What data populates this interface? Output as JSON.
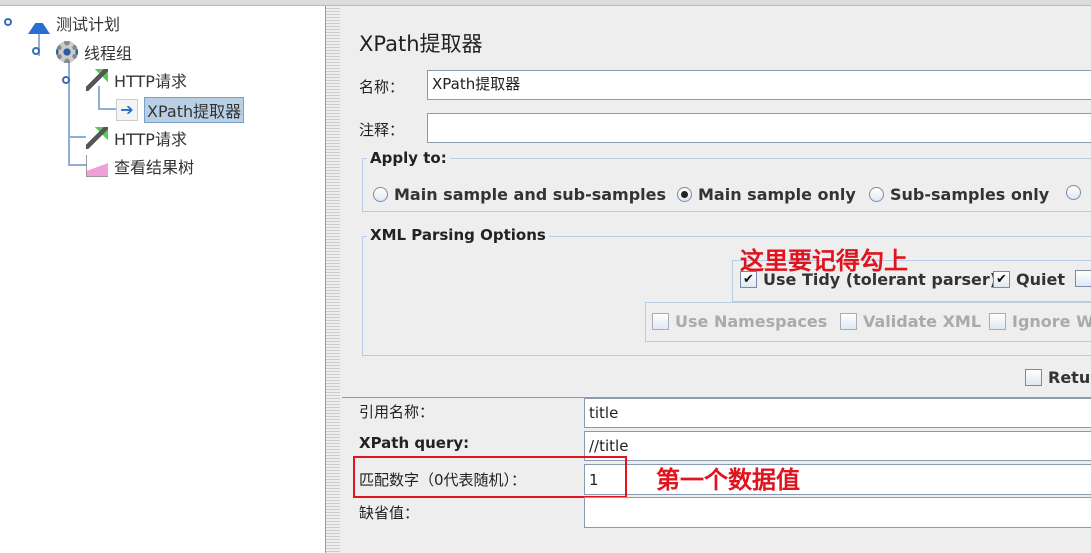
{
  "tree": {
    "items": [
      {
        "label": "测试计划",
        "icon": "flask-icon"
      },
      {
        "label": "线程组",
        "icon": "gear-icon"
      },
      {
        "label": "HTTP请求",
        "icon": "pipette-icon"
      },
      {
        "label": "XPath提取器",
        "icon": "arrow-doc-icon",
        "selected": true
      },
      {
        "label": "HTTP请求",
        "icon": "pipette-icon"
      },
      {
        "label": "查看结果树",
        "icon": "graph-icon"
      }
    ]
  },
  "panel": {
    "title": "XPath提取器",
    "name_label": "名称：",
    "name_value": "XPath提取器",
    "comment_label": "注释：",
    "comment_value": "",
    "apply_to": {
      "legend": "Apply to:",
      "options": [
        "Main sample and sub-samples",
        "Main sample only",
        "Sub-samples only"
      ],
      "selected": "Main sample only"
    },
    "xml": {
      "legend": "XML Parsing Options",
      "use_tidy": {
        "label": "Use Tidy (tolerant parser)",
        "checked": true
      },
      "quiet": {
        "label": "Quiet",
        "checked": true
      },
      "use_namespaces": {
        "label": "Use Namespaces",
        "checked": false
      },
      "validate_xml": {
        "label": "Validate XML",
        "checked": false
      },
      "ignore_whitespace": {
        "label": "Ignore W",
        "checked": false
      }
    },
    "return_label": "Retur",
    "ref_label": "引用名称：",
    "ref_value": "title",
    "xpath_label": "XPath query:",
    "xpath_value": "//title",
    "match_label": "匹配数字（0代表随机）：",
    "match_value": "1",
    "default_label": "缺省值：",
    "default_value": ""
  },
  "annotations": {
    "tidy_note": "这里要记得勾上",
    "match_note": "第一个数据值",
    "color": "#e0141e"
  }
}
